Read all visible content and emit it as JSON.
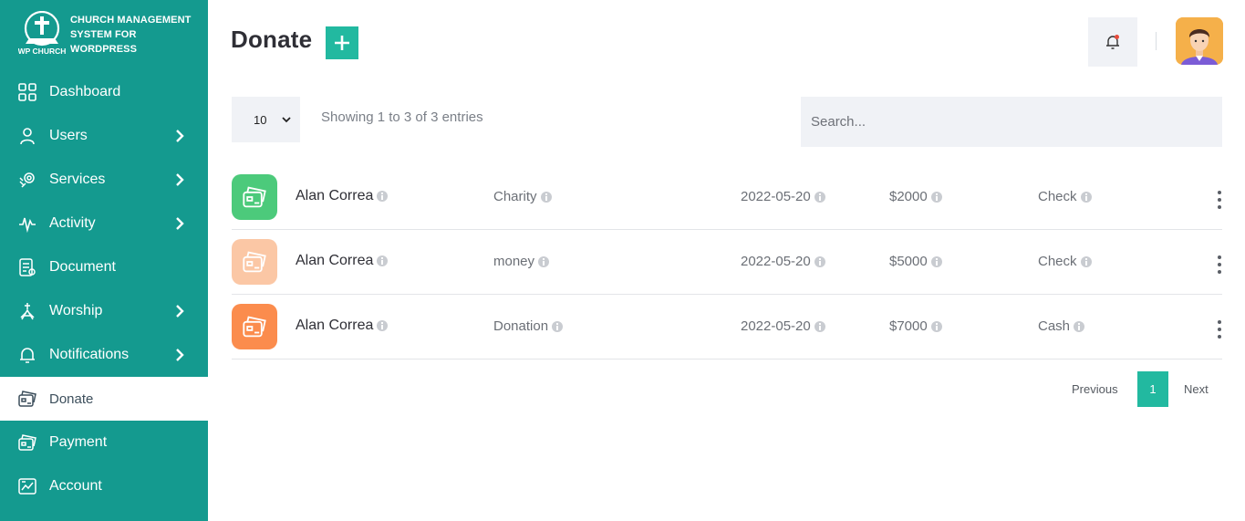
{
  "brand": {
    "logo_text": "WP CHURCH",
    "title": "CHURCH MANAGEMENT SYSTEM FOR WORDPRESS"
  },
  "sidebar": {
    "items": [
      {
        "label": "Dashboard",
        "icon": "dashboard-grid-icon",
        "has_submenu": false,
        "active": false
      },
      {
        "label": "Users",
        "icon": "user-icon",
        "has_submenu": true,
        "active": false
      },
      {
        "label": "Services",
        "icon": "services-icon",
        "has_submenu": true,
        "active": false
      },
      {
        "label": "Activity",
        "icon": "activity-pulse-icon",
        "has_submenu": true,
        "active": false
      },
      {
        "label": "Document",
        "icon": "document-icon",
        "has_submenu": false,
        "active": false
      },
      {
        "label": "Worship",
        "icon": "worship-icon",
        "has_submenu": true,
        "active": false
      },
      {
        "label": "Notifications",
        "icon": "bell-icon",
        "has_submenu": true,
        "active": false
      },
      {
        "label": "Donate",
        "icon": "donate-card-icon",
        "has_submenu": false,
        "active": true
      },
      {
        "label": "Payment",
        "icon": "payment-card-icon",
        "has_submenu": false,
        "active": false
      },
      {
        "label": "Account",
        "icon": "account-chart-icon",
        "has_submenu": false,
        "active": false
      }
    ]
  },
  "header": {
    "title": "Donate",
    "add_icon": "plus-icon",
    "notification_icon": "bell-icon",
    "notification_dot_color": "#e74c3c",
    "avatar_icon": "user-avatar"
  },
  "controls": {
    "page_size": "10",
    "showing_text": "Showing 1 to 3 of 3 entries",
    "search_placeholder": "Search..."
  },
  "rows": [
    {
      "name": "Alan Correa",
      "type": "Charity",
      "date": "2022-05-20",
      "amount": "$2000",
      "method": "Check",
      "icon_bg": "#4cca7b"
    },
    {
      "name": "Alan Correa",
      "type": "money",
      "date": "2022-05-20",
      "amount": "$5000",
      "method": "Check",
      "icon_bg": "#fbc7a5"
    },
    {
      "name": "Alan Correa",
      "type": "Donation",
      "date": "2022-05-20",
      "amount": "$7000",
      "method": "Cash",
      "icon_bg": "#fb8c4d"
    }
  ],
  "pagination": {
    "previous_label": "Previous",
    "current_page": "1",
    "next_label": "Next"
  },
  "colors": {
    "sidebar": "#149a8f",
    "accent": "#22b9a0"
  }
}
